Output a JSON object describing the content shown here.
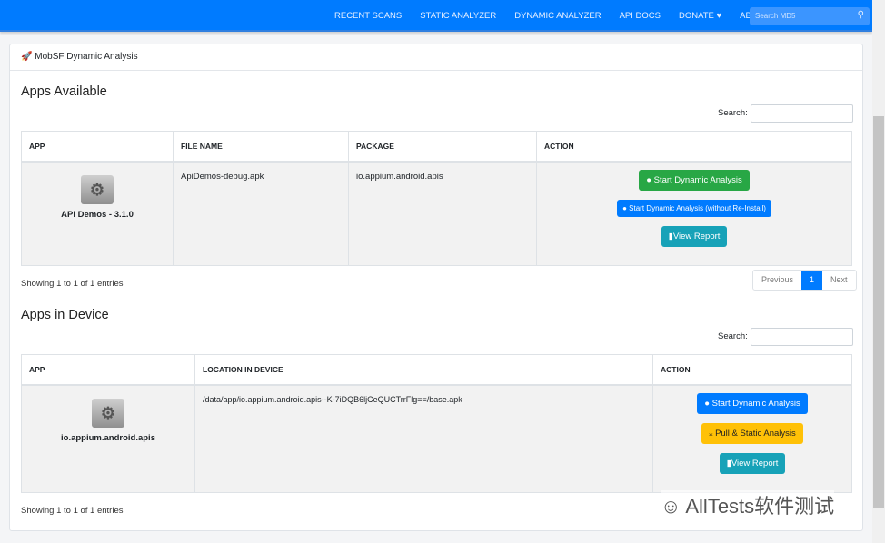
{
  "nav": {
    "items": [
      "RECENT SCANS",
      "STATIC ANALYZER",
      "DYNAMIC ANALYZER",
      "API DOCS",
      "DONATE ♥",
      "ABOUT"
    ],
    "search_placeholder": "Search MD5"
  },
  "card": {
    "title": "MobSF Dynamic Analysis"
  },
  "available": {
    "heading": "Apps Available",
    "search_label": "Search:",
    "headers": [
      "APP",
      "FILE NAME",
      "PACKAGE",
      "ACTION"
    ],
    "row": {
      "app": "API Demos - 3.1.0",
      "file": "ApiDemos-debug.apk",
      "package": "io.appium.android.apis"
    },
    "buttons": {
      "start": "Start Dynamic Analysis",
      "start_noreinstall": "Start Dynamic Analysis (without Re-Install)",
      "view": "View Report"
    },
    "info": "Showing 1 to 1 of 1 entries",
    "pagination": {
      "prev": "Previous",
      "page": "1",
      "next": "Next"
    }
  },
  "device": {
    "heading": "Apps in Device",
    "search_label": "Search:",
    "headers": [
      "APP",
      "LOCATION IN DEVICE",
      "ACTION"
    ],
    "row": {
      "app": "io.appium.android.apis",
      "location": "/data/app/io.appium.android.apis--K-7iDQB6ljCeQUCTrrFlg==/base.apk"
    },
    "buttons": {
      "start": "Start Dynamic Analysis",
      "pull": "Pull & Static Analysis",
      "view": "View Report"
    },
    "info": "Showing 1 to 1 of 1 entries"
  },
  "watermark": "AllTests软件测试",
  "colors": {
    "primary": "#007bff",
    "success": "#28a745",
    "warning": "#ffc107",
    "info": "#17a2b8"
  }
}
